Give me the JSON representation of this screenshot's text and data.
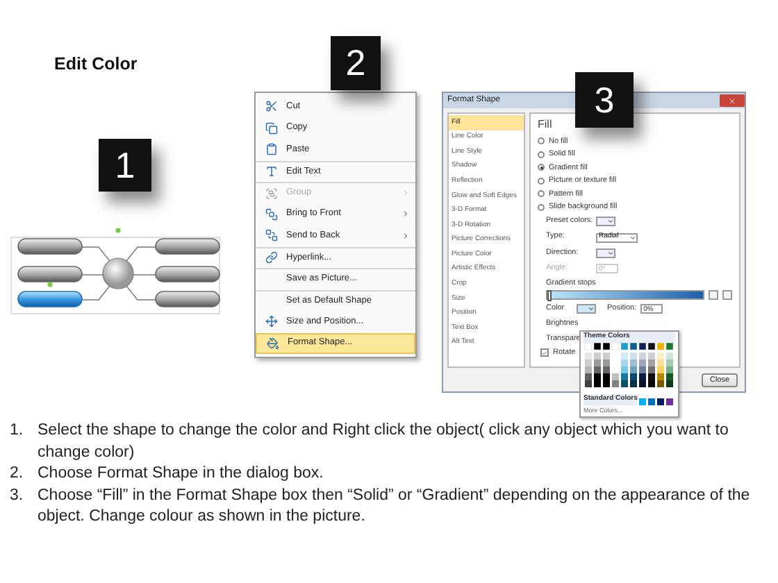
{
  "title": "Edit Color",
  "steps": [
    {
      "badge": "1"
    },
    {
      "badge": "2"
    },
    {
      "badge": "3"
    }
  ],
  "context_menu": {
    "items": [
      {
        "label": "Cut",
        "disabled": false,
        "submenu": false,
        "selected": false,
        "separator_before": false
      },
      {
        "label": "Copy",
        "disabled": false,
        "submenu": false,
        "selected": false,
        "separator_before": false
      },
      {
        "label": "Paste",
        "disabled": false,
        "submenu": false,
        "selected": false,
        "separator_before": false
      },
      {
        "label": "Edit Text",
        "disabled": false,
        "submenu": false,
        "selected": false,
        "separator_before": true
      },
      {
        "label": "Group",
        "disabled": true,
        "submenu": true,
        "selected": false,
        "separator_before": true
      },
      {
        "label": "Bring to Front",
        "disabled": false,
        "submenu": true,
        "selected": false,
        "separator_before": false
      },
      {
        "label": "Send to Back",
        "disabled": false,
        "submenu": true,
        "selected": false,
        "separator_before": false
      },
      {
        "label": "Hyperlink...",
        "disabled": false,
        "submenu": false,
        "selected": false,
        "separator_before": true
      },
      {
        "label": "Save as Picture...",
        "disabled": false,
        "submenu": false,
        "selected": false,
        "separator_before": true
      },
      {
        "label": "Set as Default Shape",
        "disabled": false,
        "submenu": false,
        "selected": false,
        "separator_before": true
      },
      {
        "label": "Size and Position...",
        "disabled": false,
        "submenu": false,
        "selected": false,
        "separator_before": false
      },
      {
        "label": "Format Shape...",
        "disabled": false,
        "submenu": false,
        "selected": true,
        "separator_before": false
      }
    ]
  },
  "dialog": {
    "title": "Format Shape",
    "categories": [
      {
        "label": "Fill",
        "selected": true
      },
      {
        "label": "Line Color",
        "selected": false
      },
      {
        "label": "Line Style",
        "selected": false
      },
      {
        "label": "Shadow",
        "selected": false
      },
      {
        "label": "Reflection",
        "selected": false
      },
      {
        "label": "Glow and Soft Edges",
        "selected": false
      },
      {
        "label": "3-D Format",
        "selected": false
      },
      {
        "label": "3-D Rotation",
        "selected": false
      },
      {
        "label": "Picture Corrections",
        "selected": false
      },
      {
        "label": "Picture Color",
        "selected": false
      },
      {
        "label": "Artistic Effects",
        "selected": false
      },
      {
        "label": "Crop",
        "selected": false
      },
      {
        "label": "Size",
        "selected": false
      },
      {
        "label": "Position",
        "selected": false
      },
      {
        "label": "Text Box",
        "selected": false
      },
      {
        "label": "Alt Text",
        "selected": false
      }
    ],
    "heading": "Fill",
    "fill_options": [
      {
        "label": "No fill",
        "selected": false
      },
      {
        "label": "Solid fill",
        "selected": false
      },
      {
        "label": "Gradient fill",
        "selected": true
      },
      {
        "label": "Picture or texture fill",
        "selected": false
      },
      {
        "label": "Pattern fill",
        "selected": false
      },
      {
        "label": "Slide background fill",
        "selected": false
      }
    ],
    "preset_colors_label": "Preset colors:",
    "type_label": "Type:",
    "type_value": "Radial",
    "direction_label": "Direction:",
    "angle": {
      "label": "Angle:",
      "value": "0°",
      "disabled": true
    },
    "gradient_stops_label": "Gradient stops",
    "color_label": "Color",
    "position": {
      "label": "Position:",
      "value": "0%"
    },
    "brightness_label": "Brightnes",
    "transparency_label": "Transpare",
    "rotate": {
      "label": "Rotate",
      "checked": true
    },
    "close_button": "Close",
    "color_popup": {
      "theme_label": "Theme Colors",
      "standard_label": "Standard Colors",
      "more_label": "More Colors..."
    }
  },
  "instructions": [
    {
      "number": "1.",
      "text": "Select the shape to change the color and Right click the object( click any object which you want to change color)"
    },
    {
      "number": "2.",
      "text": "Choose Format Shape in the dialog box."
    },
    {
      "number": "3.",
      "text": "Choose “Fill” in the Format Shape box then “Solid” or “Gradient” depending on the appearance of the object. Change colour as shown in the picture."
    }
  ]
}
